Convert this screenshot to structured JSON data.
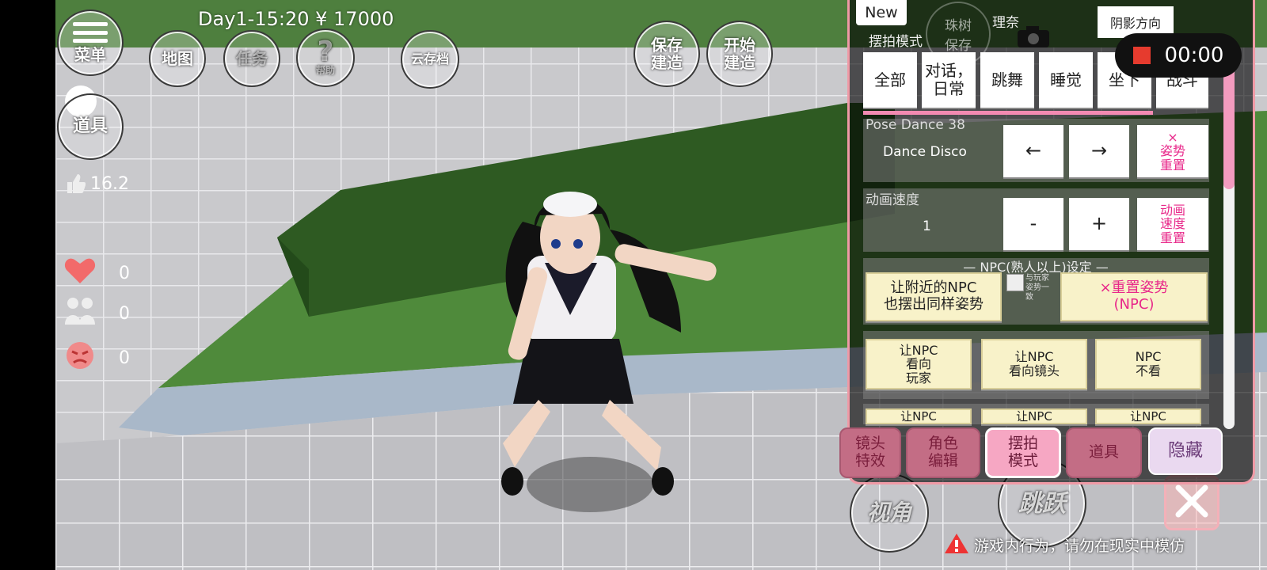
{
  "hud": {
    "day_time": "Day1-15:20",
    "money": "¥ 17000",
    "menu_label": "菜单",
    "map_label": "地图",
    "task_label": "任务",
    "help_label": "帮助",
    "help_glyph": "?",
    "cloud_label": "云存档",
    "items_label": "道具",
    "save_build_label": "保存\n建造",
    "start_build_label": "开始\n建造",
    "fps_value": "16.2",
    "heart_count": "0",
    "friends_count": "0",
    "anger_count": "0",
    "view_label": "视角",
    "jump_label": "跳跃",
    "warning_text": "游戏内行为，请勿在现实中模仿"
  },
  "panel": {
    "new_label": "New",
    "top_name1": "珠树",
    "top_save": "保存",
    "top_name2": "理奈",
    "shadow_label": "阴影方向",
    "mode_title": "摆拍模式",
    "categories": [
      "全部",
      "对话，\n日常",
      "跳舞",
      "睡觉",
      "坐下",
      "战斗"
    ],
    "pose_title": "Pose Dance 38",
    "pose_name": "Dance Disco",
    "prev_arrow": "←",
    "next_arrow": "→",
    "pose_reset": "×\n姿势\n重置",
    "speed_title": "动画速度",
    "speed_value": "1",
    "speed_minus": "-",
    "speed_plus": "+",
    "speed_reset": "动画\n速度\n重置",
    "npc_header": "— NPC(熟人以上)设定 —",
    "npc_same_pose": "让附近的NPC\n也摆出同样姿势",
    "match_player": "与玩家\n姿势一\n致",
    "npc_reset_pose": "×重置姿势\n(NPC)",
    "npc_look_player": "让NPC\n看向\n玩家",
    "npc_look_camera": "让NPC\n看向镜头",
    "npc_no_look": "NPC\n不看",
    "npc_partial": [
      "让NPC",
      "让NPC",
      "让NPC"
    ],
    "tabs": [
      "镜头\n特效",
      "角色\n编辑",
      "摆拍\n模式",
      "道具"
    ],
    "hide_label": "隐藏"
  },
  "recorder": {
    "time": "00:00",
    "color": "#e63b2e"
  },
  "colors": {
    "panel_border": "#ef9aa6",
    "pink_text": "#e8288a",
    "hedge": "#2e5a22"
  }
}
